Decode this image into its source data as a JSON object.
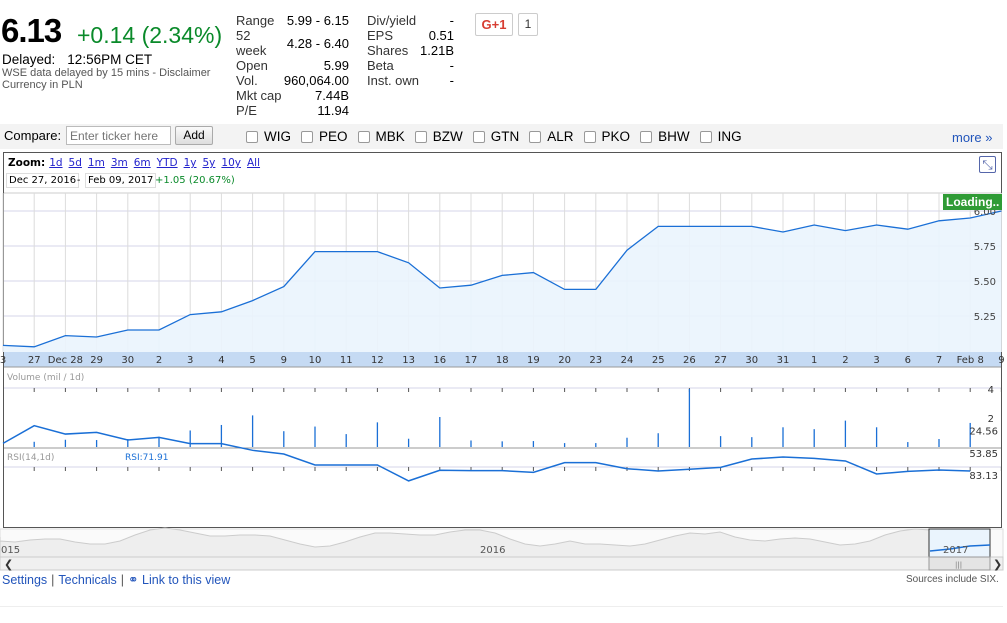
{
  "quote": {
    "price": "6.13",
    "change": "+0.14 (2.34%)",
    "delayed_label": "Delayed:",
    "time": "12:56PM CET",
    "disclaimer": "WSE data delayed by 15 mins - Disclaimer",
    "currency": "Currency in PLN"
  },
  "stats_left": [
    {
      "k": "Range",
      "v": "5.99 - 6.15"
    },
    {
      "k": "52 week",
      "v": "4.28 - 6.40"
    },
    {
      "k": "Open",
      "v": "5.99"
    },
    {
      "k": "Vol.",
      "v": "960,064.00"
    },
    {
      "k": "Mkt cap",
      "v": "7.44B"
    },
    {
      "k": "P/E",
      "v": "11.94"
    }
  ],
  "stats_right": [
    {
      "k": "Div/yield",
      "v": "-"
    },
    {
      "k": "EPS",
      "v": "0.51"
    },
    {
      "k": "Shares",
      "v": "1.21B"
    },
    {
      "k": "Beta",
      "v": "-"
    },
    {
      "k": "Inst. own",
      "v": "-"
    }
  ],
  "social": {
    "gplus": "G+1",
    "count": "1"
  },
  "compare": {
    "label": "Compare:",
    "placeholder": "Enter ticker here",
    "add": "Add",
    "tickers": [
      "WIG",
      "PEO",
      "MBK",
      "BZW",
      "GTN",
      "ALR",
      "PKO",
      "BHW",
      "ING"
    ],
    "more": "more »"
  },
  "toolbar": {
    "zoom_label": "Zoom:",
    "zooms": [
      "1d",
      "5d",
      "1m",
      "3m",
      "6m",
      "YTD",
      "1y",
      "5y",
      "10y",
      "All"
    ],
    "start": "Dec 27, 2016",
    "dash": "-",
    "end": "Feb 09, 2017",
    "range_change": "+1.05 (20.67%)",
    "loading": "Loading.."
  },
  "chart_data": {
    "type": "line",
    "x": [
      "3",
      "27",
      "Dec 28",
      "29",
      "30",
      "2",
      "3",
      "4",
      "5",
      "9",
      "10",
      "11",
      "12",
      "13",
      "16",
      "17",
      "18",
      "19",
      "20",
      "23",
      "24",
      "25",
      "26",
      "27",
      "30",
      "31",
      "1",
      "2",
      "3",
      "6",
      "7",
      "Feb 8",
      "9"
    ],
    "price": {
      "values": [
        5.04,
        5.03,
        5.11,
        5.1,
        5.15,
        5.15,
        5.26,
        5.28,
        5.36,
        5.46,
        5.71,
        5.71,
        5.71,
        5.63,
        5.45,
        5.47,
        5.54,
        5.56,
        5.44,
        5.44,
        5.72,
        5.89,
        5.89,
        5.89,
        5.89,
        5.85,
        5.9,
        5.86,
        5.9,
        5.87,
        5.93,
        5.95,
        6.0
      ],
      "yticks": [
        "5.25",
        "5.50",
        "5.75",
        "6.00"
      ],
      "ylim": [
        5.0,
        6.1
      ]
    },
    "volume": {
      "label": "Volume (mil / 1d)",
      "values": [
        0.36,
        0.5,
        0.48,
        0.55,
        0.7,
        1.14,
        1.52,
        2.18,
        1.09,
        1.41,
        0.89,
        1.7,
        0.57,
        2.07,
        0.45,
        0.39,
        0.41,
        0.27,
        0.27,
        0.64,
        0.95,
        4.0,
        0.75,
        0.68,
        1.36,
        1.23,
        1.82,
        1.36,
        0.34,
        0.55,
        1.66
      ],
      "yticks": [
        "4",
        "2"
      ]
    },
    "rsi": {
      "label": "RSI(14,1d)",
      "current": "RSI:71.91",
      "values": [
        41.3,
        17.9,
        29.0,
        26.8,
        36.9,
        33.4,
        41.7,
        41.7,
        50.5,
        55.4,
        69.9,
        69.9,
        69.9,
        90.9,
        76.9,
        77.4,
        77.4,
        79.6,
        66.8,
        66.8,
        74.8,
        77.8,
        75.6,
        73.0,
        62.0,
        59.4,
        61.1,
        64.6,
        81.8,
        78.3,
        76.5,
        77.8
      ],
      "yticks": [
        "83.13",
        "53.85",
        "24.56"
      ]
    },
    "navigator": {
      "labels": [
        "015",
        "2016",
        "2017"
      ]
    }
  },
  "footer": {
    "settings": "Settings",
    "technicals": "Technicals",
    "link": "Link to this view",
    "sources": "Sources include SIX."
  },
  "colors": {
    "line": "#1a6fd6",
    "fill": "#eaf4fd",
    "axisband": "#c5daf3",
    "up": "#0a8a2a"
  }
}
